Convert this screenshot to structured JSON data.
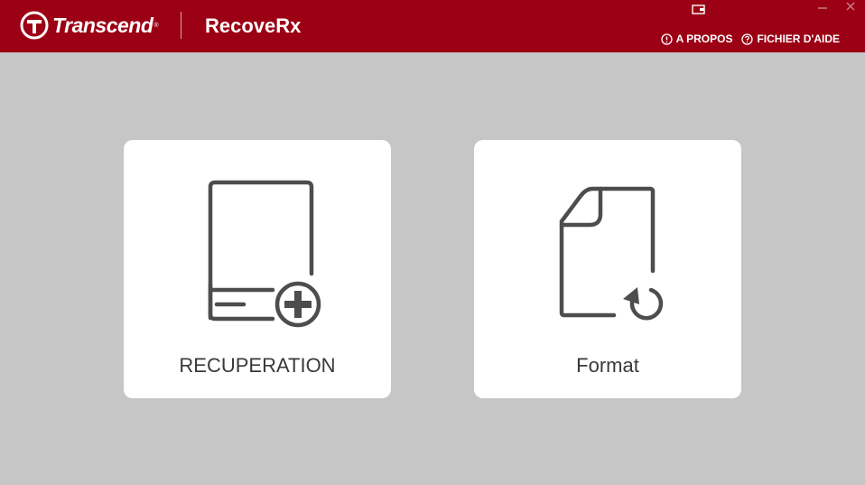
{
  "header": {
    "brand": "Transcend",
    "brand_mark": "®",
    "app_title": "RecoveRx",
    "links": [
      {
        "label": "A PROPOS",
        "icon": "info-circle-icon"
      },
      {
        "label": "FICHIER D'AIDE",
        "icon": "help-circle-icon"
      }
    ],
    "window_controls": [
      "tray-icon",
      "minimize-icon",
      "close-icon"
    ]
  },
  "cards": [
    {
      "label": "RECUPERATION",
      "icon": "drive-add-icon"
    },
    {
      "label": "Format",
      "icon": "document-restore-icon"
    }
  ],
  "colors": {
    "header_bg": "#9b0014",
    "page_bg": "#c6c6c6",
    "card_bg": "#ffffff",
    "icon_gray": "#4d4d4d"
  }
}
